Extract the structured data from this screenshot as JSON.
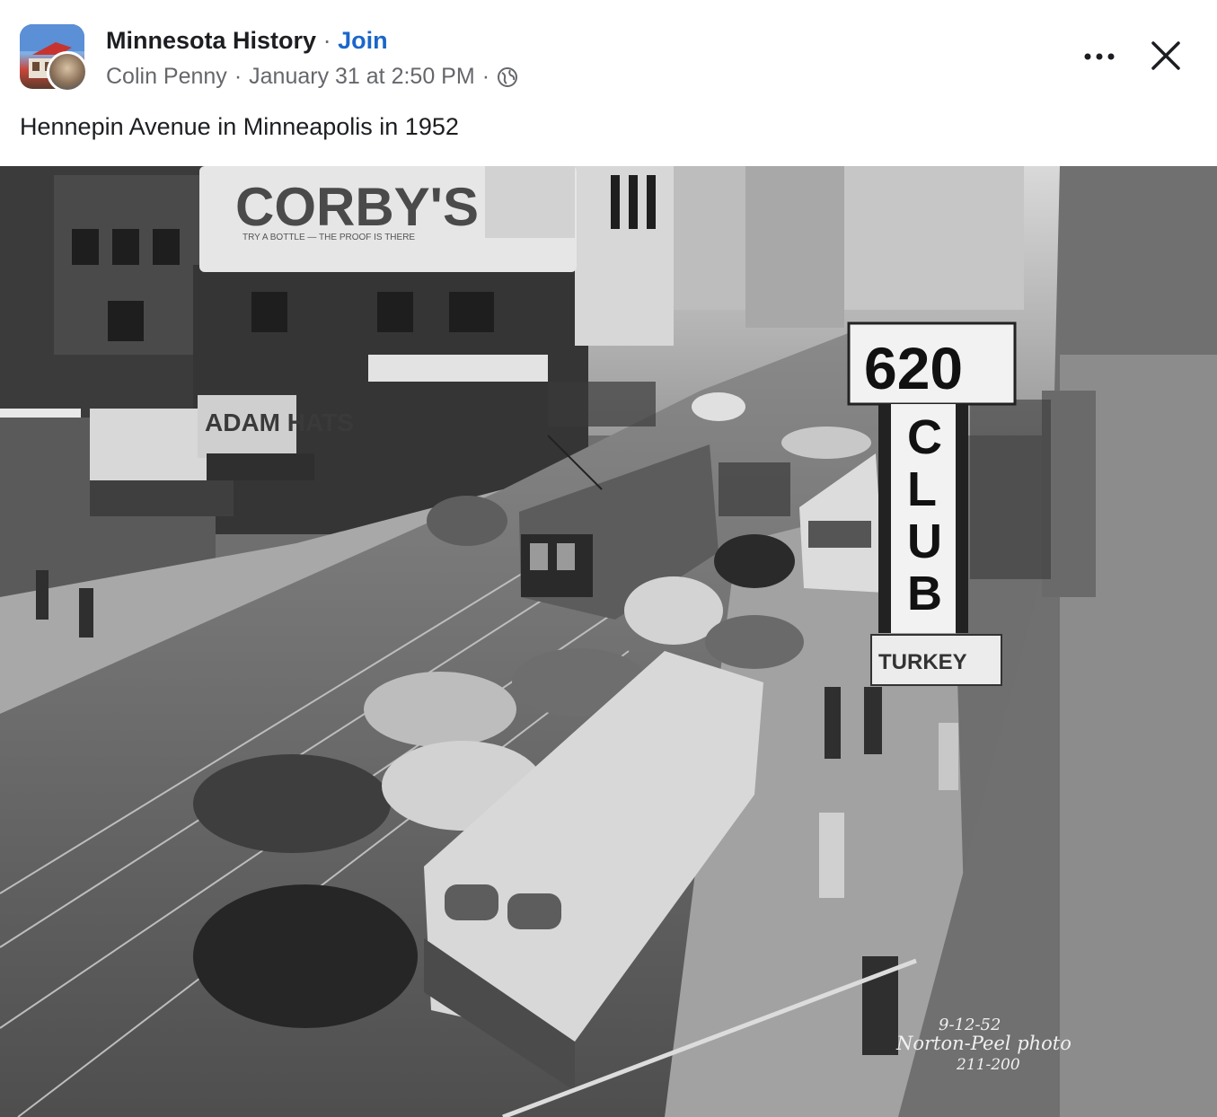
{
  "post": {
    "group_name": "Minnesota History",
    "separator": "·",
    "join_label": "Join",
    "author": "Colin Penny",
    "timestamp": "January 31 at 2:50 PM",
    "privacy_icon": "globe-icon",
    "text": "Hennepin Avenue in Minneapolis in 1952"
  },
  "actions": {
    "more_icon": "more-icon",
    "close_icon": "close-icon"
  },
  "photo": {
    "signs": {
      "corbys": "CORBY'S",
      "corbys_tagline": "TRY A BOTTLE — THE PROOF IS THERE",
      "adam_hats": "ADAM HATS",
      "club_number": "620",
      "club_letters": [
        "C",
        "L",
        "U",
        "B"
      ],
      "turkey": "TURKEY"
    },
    "caption": {
      "date": "9-12-52",
      "credit": "Norton-Peel photo",
      "number": "211-200"
    }
  },
  "colors": {
    "link": "#1b66c9",
    "text_primary": "#1c1e21",
    "text_secondary": "#65676b"
  }
}
